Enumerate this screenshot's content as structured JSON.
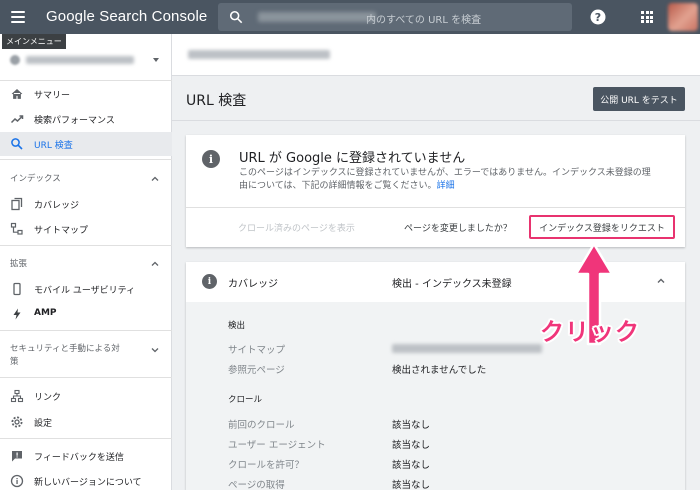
{
  "app": {
    "title": "Google Search Console",
    "search_placeholder": "内のすべての URL を検査",
    "tooltip": "メインメニュー"
  },
  "sidebar": {
    "items": [
      {
        "label": "サマリー",
        "icon": "home-icon"
      },
      {
        "label": "検索パフォーマンス",
        "icon": "trend-icon"
      },
      {
        "label": "URL 検査",
        "icon": "search-icon",
        "active": true
      }
    ],
    "index_section": {
      "title": "インデックス",
      "items": [
        {
          "label": "カバレッジ",
          "icon": "copy-icon"
        },
        {
          "label": "サイトマップ",
          "icon": "sitemap-icon"
        }
      ]
    },
    "enhance_section": {
      "title": "拡張",
      "items": [
        {
          "label": "モバイル ユーザビリティ",
          "icon": "phone-icon"
        },
        {
          "label": "AMP",
          "icon": "bolt-icon"
        }
      ]
    },
    "security_section": {
      "title_line1": "セキュリティと手動による対",
      "title_line2": "策"
    },
    "bottom_items": [
      {
        "label": "リンク",
        "icon": "link-network-icon"
      },
      {
        "label": "設定",
        "icon": "gear-icon"
      },
      {
        "label": "フィードバックを送信",
        "icon": "feedback-icon"
      },
      {
        "label": "新しいバージョンについて",
        "icon": "info-icon"
      }
    ]
  },
  "main": {
    "page_title": "URL 検査",
    "test_button": "公開 URL をテスト",
    "status_card": {
      "title": "URL が Google に登録されていません",
      "desc": "このページはインデックスに登録されていませんが、エラーではありません。インデックス未登録の理由については、下記の詳細情報をご覧ください。",
      "link": "詳細",
      "crawled_link": "クロール済みのページを表示",
      "changed_question": "ページを変更しましたか？",
      "request_button": "インデックス登録をリクエスト"
    },
    "coverage": {
      "label": "カバレッジ",
      "status": "検出 - インデックス未登録",
      "discovery_heading": "検出",
      "sitemap_label": "サイトマップ",
      "referring_label": "参照元ページ",
      "referring_value": "検出されませんでした",
      "crawl_heading": "クロール",
      "rows": [
        {
          "label": "前回のクロール",
          "value": "該当なし"
        },
        {
          "label": "ユーザー エージェント",
          "value": "該当なし"
        },
        {
          "label": "クロールを許可？",
          "value": "該当なし"
        },
        {
          "label": "ページの取得",
          "value": "該当なし"
        }
      ]
    }
  },
  "annotation": {
    "text": "クリック",
    "color": "#f0357a"
  }
}
